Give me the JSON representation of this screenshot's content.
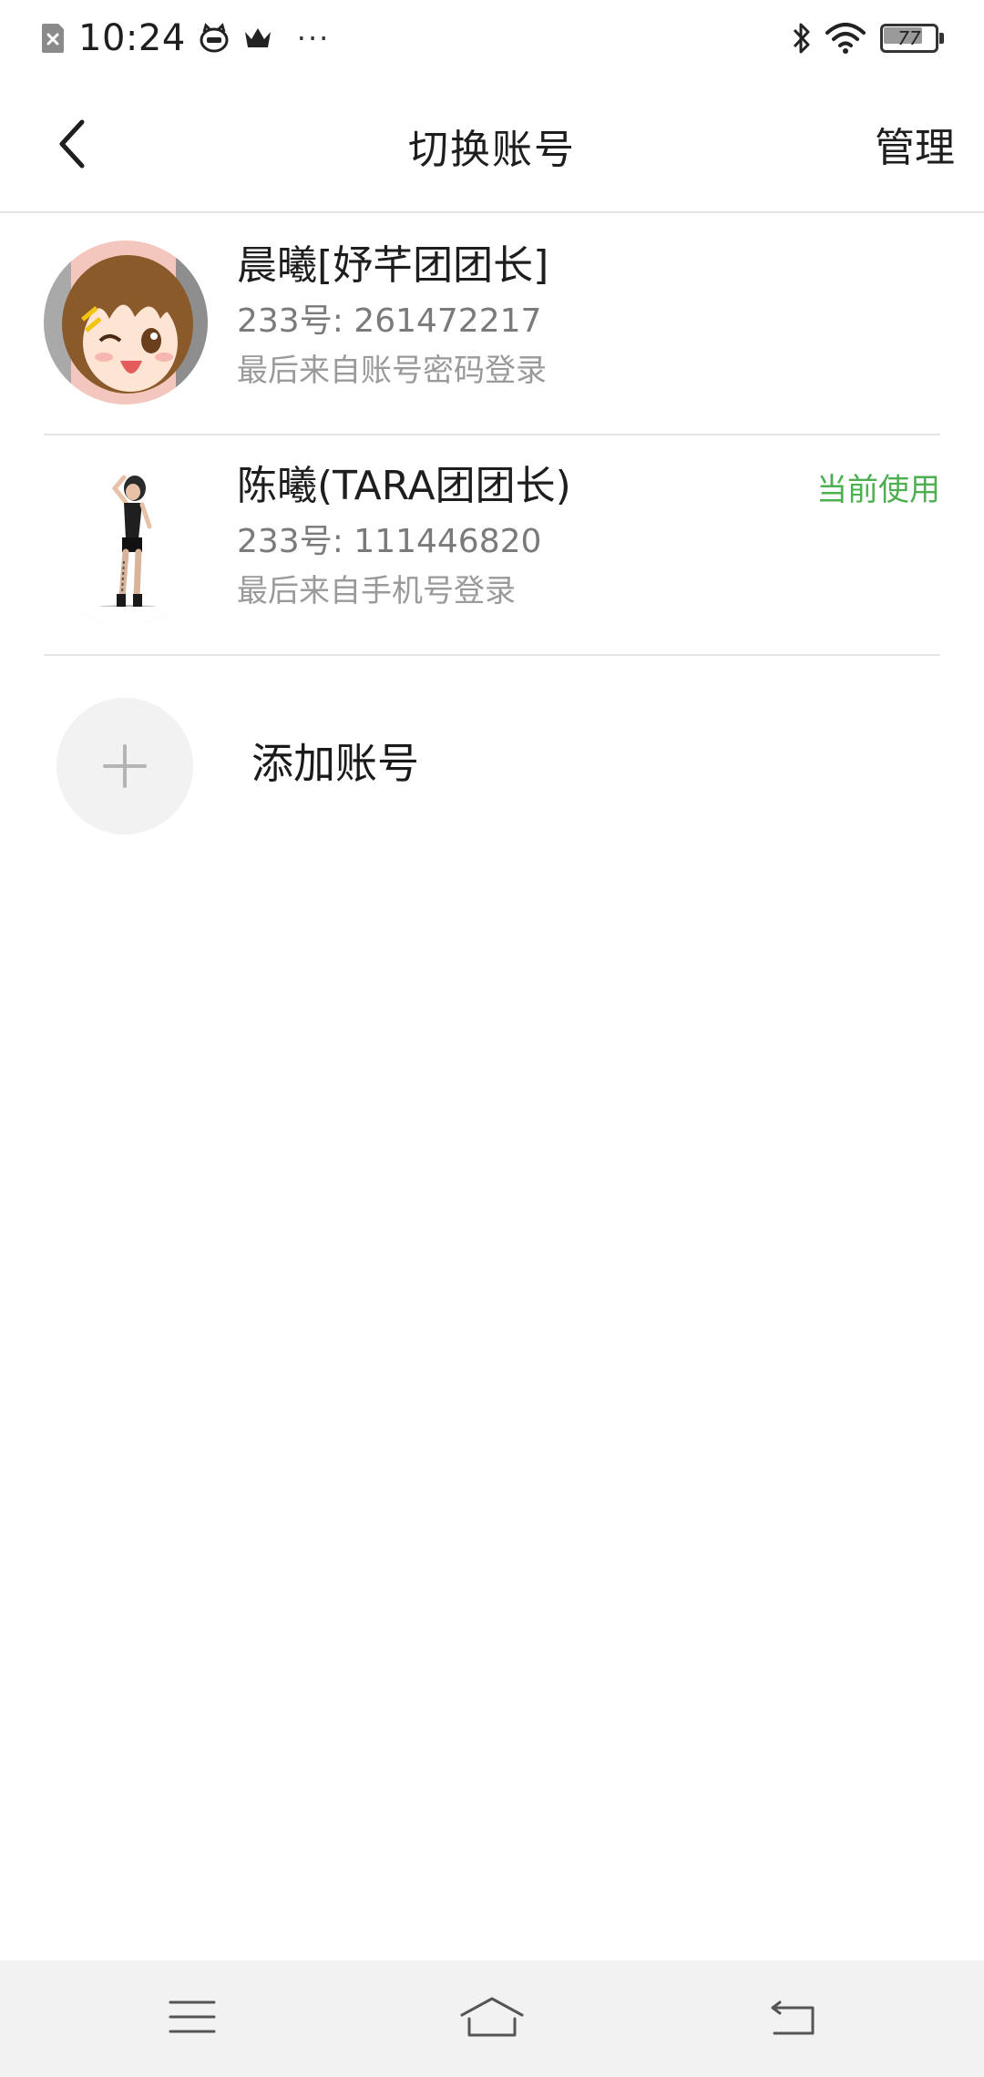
{
  "status_bar": {
    "time": "10:24",
    "more": "···",
    "battery": "77",
    "icons": [
      "sim-blocked-icon",
      "app-cat-icon",
      "crown-icon",
      "bluetooth-icon",
      "wifi-icon",
      "battery-icon"
    ]
  },
  "header": {
    "back_icon": "chevron-left-icon",
    "title": "切换账号",
    "manage_label": "管理"
  },
  "accounts": [
    {
      "name": "晨曦[妤芊团团长]",
      "uid": "233号: 261472217",
      "last_login": "最后来自账号密码登录",
      "current": false,
      "avatar": "anime-girl-avatar"
    },
    {
      "name": "陈曦(TARA团团长)",
      "uid": "233号: 111446820",
      "last_login": "最后来自手机号登录",
      "current": true,
      "current_label": "当前使用",
      "avatar": "figure-avatar"
    }
  ],
  "add_account": {
    "label": "添加账号",
    "icon": "plus-icon"
  },
  "nav_bar": {
    "icons": [
      "menu-icon",
      "home-icon",
      "back-icon"
    ]
  },
  "colors": {
    "accent_green": "#4caf50",
    "divider": "#e6e6e6",
    "nav_bg": "#f2f2f2"
  }
}
